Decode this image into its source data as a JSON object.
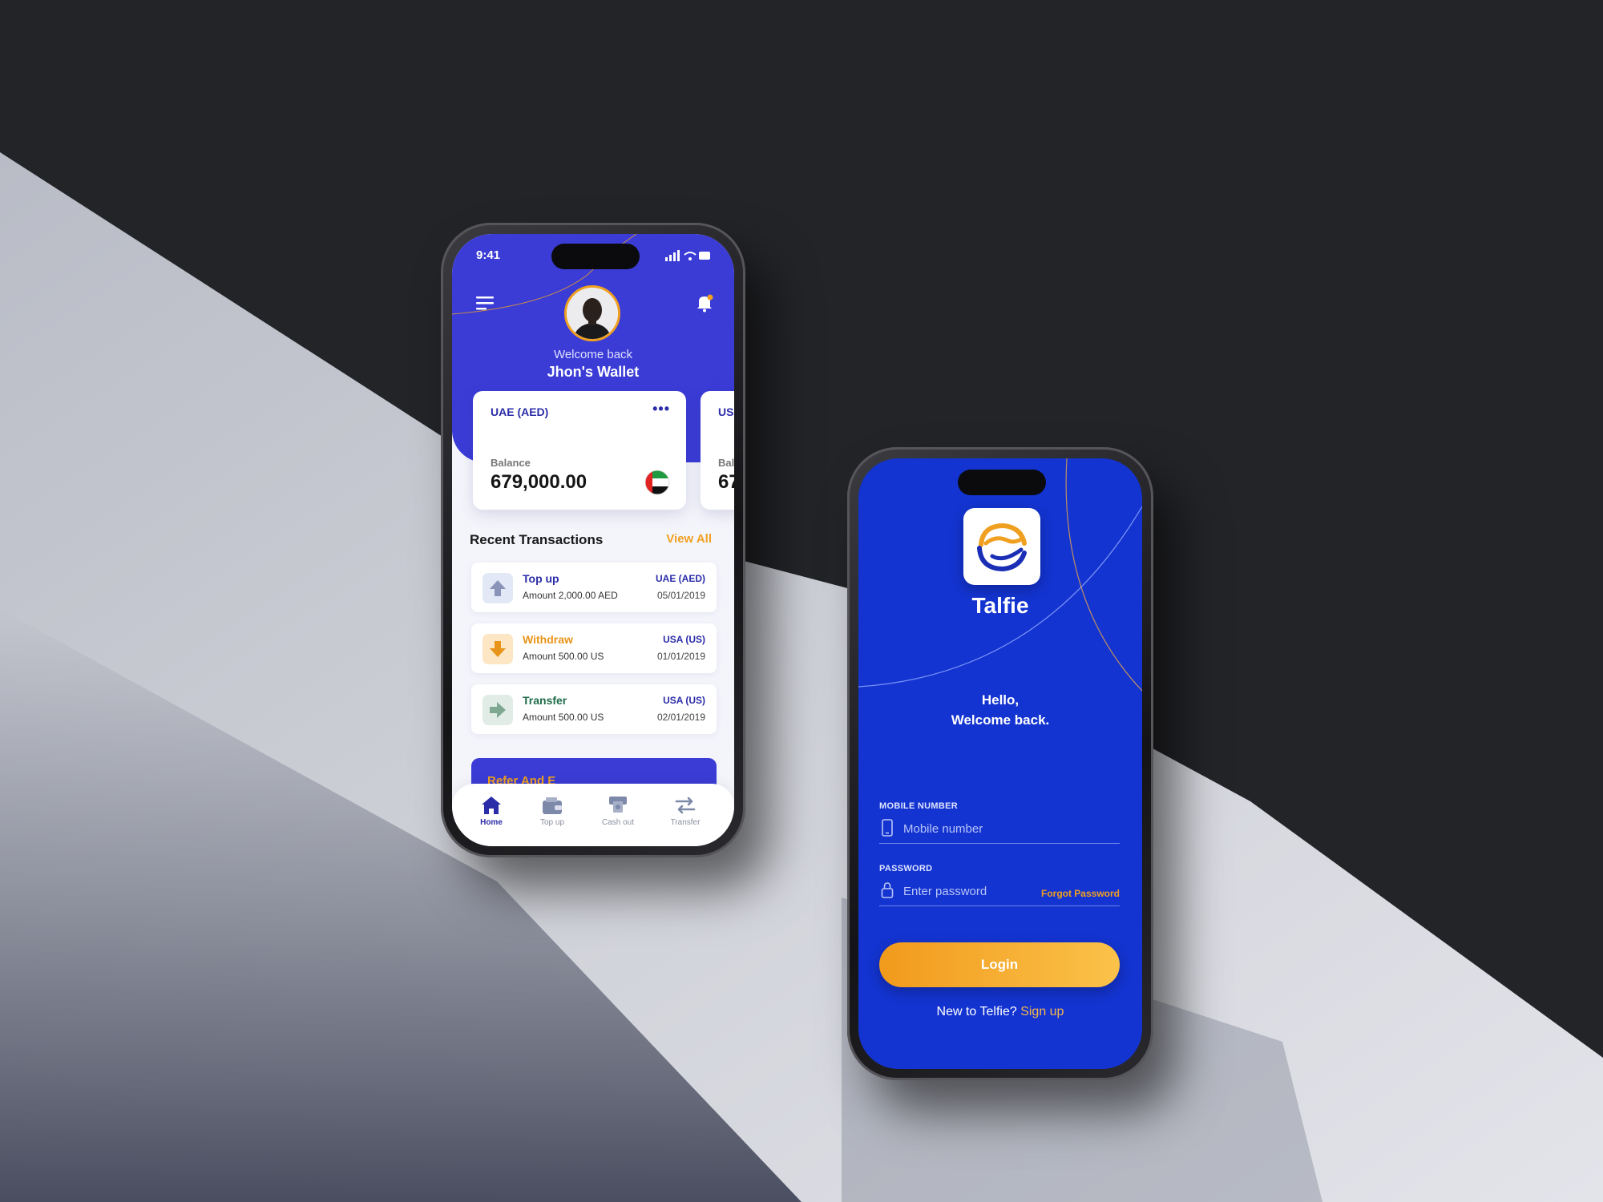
{
  "wallet_screen": {
    "status_time": "9:41",
    "welcome_text": "Welcome back",
    "wallet_name": "Jhon's Wallet",
    "cards": [
      {
        "currency": "UAE (AED)",
        "balance_label": "Balance",
        "balance": "679,000.00",
        "more": "•••"
      },
      {
        "currency": "USA",
        "balance_label": "Bal",
        "balance": "67"
      }
    ],
    "recent_transactions_title": "Recent Transactions",
    "view_all_label": "View All",
    "transactions": [
      {
        "type": "Top up",
        "amount": "Amount 2,000.00 AED",
        "currency": "UAE (AED)",
        "date": "05/01/2019",
        "color": "#2b2ca8",
        "icon": "arrow-up-icon"
      },
      {
        "type": "Withdraw",
        "amount": "Amount 500.00 US",
        "currency": "USA (US)",
        "date": "01/01/2019",
        "color": "#e8941a",
        "icon": "arrow-down-icon"
      },
      {
        "type": "Transfer",
        "amount": "Amount 500.00 US",
        "currency": "USA (US)",
        "date": "02/01/2019",
        "color": "#1f6b4a",
        "icon": "arrow-right-icon"
      }
    ],
    "promo_text": "Refer And E",
    "tabs": [
      {
        "label": "Home",
        "icon": "home-icon",
        "active": true
      },
      {
        "label": "Top up",
        "icon": "wallet-icon"
      },
      {
        "label": "Cash out",
        "icon": "cash-out-icon"
      },
      {
        "label": "Transfer",
        "icon": "transfer-icon"
      }
    ]
  },
  "login_screen": {
    "brand": "Talfie",
    "greeting_line1": "Hello,",
    "greeting_line2": "Welcome back.",
    "mobile_label": "MOBILE NUMBER",
    "mobile_placeholder": "Mobile number",
    "password_label": "PASSWORD",
    "password_placeholder": "Enter password",
    "forgot_password": "Forgot Password",
    "login_button": "Login",
    "new_user_text": "New to Telfie?",
    "signup_link": "Sign up"
  },
  "colors": {
    "brand_blue": "#3b3cd6",
    "login_blue": "#1334d0",
    "accent_orange": "#f0a020"
  }
}
